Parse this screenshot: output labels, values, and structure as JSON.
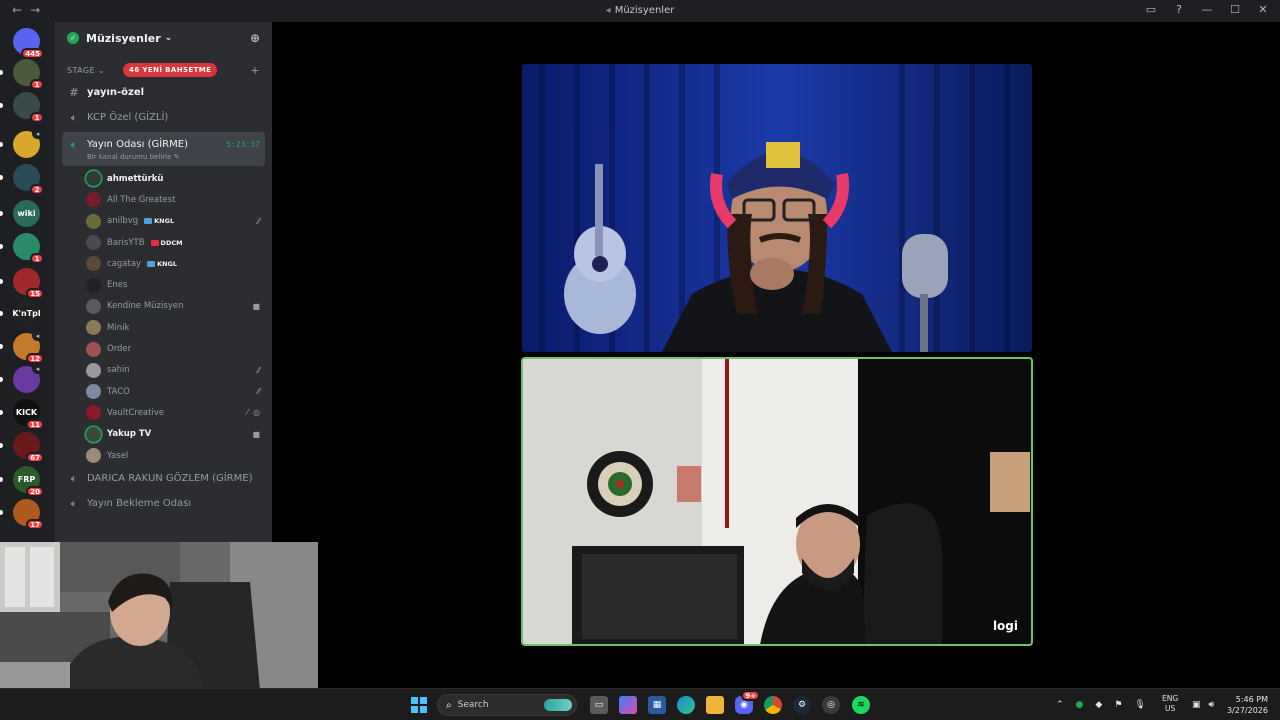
{
  "window": {
    "title": "Müzisyenler",
    "back_icon": "arrow-left-icon",
    "forward_icon": "arrow-right-icon"
  },
  "rail": {
    "servers": [
      {
        "name": "discord-home",
        "badge": "445",
        "color": "#5865f2"
      },
      {
        "name": "server-2",
        "badge": "1",
        "color": "#4a5a3a"
      },
      {
        "name": "server-3",
        "badge": "1",
        "color": "#3a4a4a"
      },
      {
        "name": "server-4",
        "badge": "",
        "color": "#d8a72c"
      },
      {
        "name": "server-5",
        "badge": "2",
        "color": "#2a4a5a"
      },
      {
        "name": "server-wiki",
        "badge": "",
        "label": "wiki",
        "color": "#2a6a5a"
      },
      {
        "name": "server-7",
        "badge": "1",
        "color": "#2a8a6a"
      },
      {
        "name": "server-8",
        "badge": "15",
        "color": "#a02a2a"
      },
      {
        "name": "server-kntpl",
        "badge": "",
        "label": "K'nTpl",
        "color": "#222"
      },
      {
        "name": "server-10",
        "badge": "12",
        "color": "#c47a2a"
      },
      {
        "name": "server-11",
        "badge": "",
        "color": "#6a3aa0"
      },
      {
        "name": "server-kick",
        "badge": "11",
        "label": "KICK",
        "color": "#111"
      },
      {
        "name": "server-13",
        "badge": "67",
        "color": "#6a1a1a"
      },
      {
        "name": "server-frp",
        "badge": "20",
        "label": "FRP",
        "color": "#2a5a2a"
      },
      {
        "name": "server-15",
        "badge": "17",
        "color": "#b05a20"
      }
    ]
  },
  "sidebar": {
    "server_name": "Müzisyenler",
    "category": "STAGE",
    "mention_pill": "46 YENİ BAHSETME",
    "channels_top": [
      {
        "name": "yayın-özel",
        "type": "text"
      },
      {
        "name": "KCP Özel (GİZLİ)",
        "type": "voice"
      }
    ],
    "active_channel": {
      "name": "Yayın Odası (GİRME)",
      "timer": "5:23:37",
      "status": "Bir kanal durumu belirle"
    },
    "users": [
      {
        "name": "ahmettürkü",
        "bright": true,
        "speaking": true,
        "avatar": "#2f3a35",
        "tag": "",
        "icons": []
      },
      {
        "name": "All The Greatest",
        "avatar": "#7a1a2a",
        "tag": "",
        "icons": []
      },
      {
        "name": "anilbvg",
        "avatar": "#6a6a3a",
        "tag": "KNGL",
        "tag_color": "blue",
        "icons": [
          "deafen-off-icon"
        ]
      },
      {
        "name": "BarisYTB",
        "avatar": "#4a4a55",
        "tag": "DDCM",
        "tag_color": "red",
        "icons": []
      },
      {
        "name": "cagatay",
        "avatar": "#5a4a3a",
        "tag": "KNGL",
        "tag_color": "blue",
        "icons": []
      },
      {
        "name": "Enes",
        "avatar": "#222",
        "tag": "",
        "icons": []
      },
      {
        "name": "Kendine Müzisyen",
        "avatar": "#5a5a5a",
        "tag": "",
        "icons": [
          "camera-icon"
        ]
      },
      {
        "name": "Minik",
        "avatar": "#8a7a5a",
        "tag": "",
        "icons": []
      },
      {
        "name": "Order",
        "avatar": "#a05050",
        "tag": "",
        "icons": []
      },
      {
        "name": "sahin",
        "avatar": "#9a9a9a",
        "tag": "",
        "icons": [
          "deafen-off-icon"
        ]
      },
      {
        "name": "TACO",
        "avatar": "#7a8aa0",
        "tag": "",
        "icons": [
          "deafen-off-icon"
        ]
      },
      {
        "name": "VaultCreative",
        "avatar": "#8a1a2a",
        "tag": "",
        "icons": [
          "mute-icon",
          "deafen-icon"
        ]
      },
      {
        "name": "Yakup TV",
        "bright": true,
        "speaking": true,
        "avatar": "#3a4a3a",
        "tag": "",
        "icons": [
          "camera-icon"
        ]
      },
      {
        "name": "Yasel",
        "avatar": "#9a8a7a",
        "tag": "",
        "icons": []
      }
    ],
    "channels_bottom": [
      {
        "name": "DARICA RAKUN GÖZLEM (GİRME)",
        "type": "voice"
      },
      {
        "name": "Yayın Bekleme Odası",
        "type": "voice"
      }
    ]
  },
  "stage": {
    "tile2_watermark": "logi"
  },
  "taskbar": {
    "search_placeholder": "Search",
    "discord_badge": "9+",
    "lang_top": "ENG",
    "lang_bottom": "US",
    "time": "5:46 PM",
    "date": "3/27/2026"
  }
}
